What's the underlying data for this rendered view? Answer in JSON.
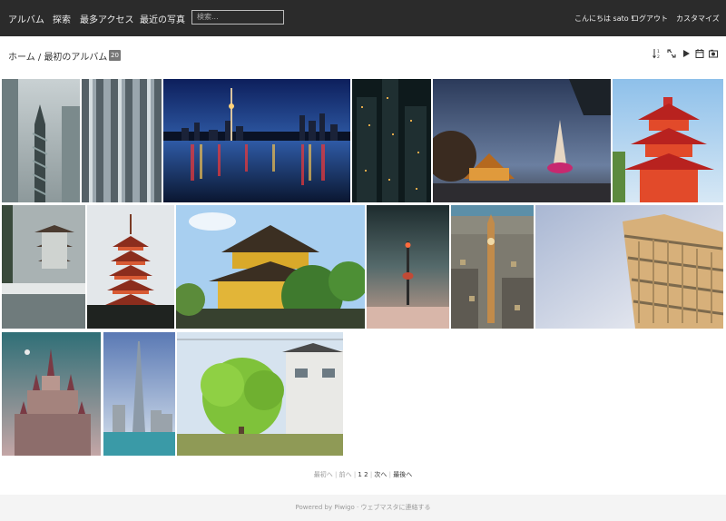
{
  "nav": {
    "album": "アルバム",
    "explore": "探索",
    "most_visited": "最多アクセス",
    "recent_photos": "最近の写真",
    "search_placeholder": "検索...",
    "greeting": "こんにちは sato !",
    "logout": "ログアウト",
    "customize": "カスタマイズ"
  },
  "breadcrumb": {
    "home": "ホーム",
    "separator": " / ",
    "album": "最初のアルバム",
    "count": "20"
  },
  "tools": [
    "sort-icon",
    "view-toggle-icon",
    "slideshow-icon",
    "calendar-icon",
    "metadata-icon"
  ],
  "photos": [
    "spiral-tower",
    "glass-facade",
    "city-skyline-night",
    "dark-skyscrapers",
    "temple-night",
    "red-pagoda",
    "garden-pagoda",
    "five-story-pagoda",
    "golden-pavilion",
    "tower-in-fog",
    "big-ben-london",
    "leaning-tower-pisa",
    "fairytale-castle",
    "burj-khalifa",
    "green-tree-garden"
  ],
  "pager": {
    "first": "最初へ",
    "prev": "前へ",
    "page_1": "1",
    "page_2": "2",
    "next": "次へ",
    "last": "最後へ",
    "sep": "|"
  },
  "footer": {
    "powered": "Powered by",
    "piwigo": "Piwigo",
    "dash": " · ",
    "contact": "ウェブマスタに連絡する"
  },
  "colors": {
    "topbar": "#2b2b2b",
    "badge": "#777777"
  }
}
